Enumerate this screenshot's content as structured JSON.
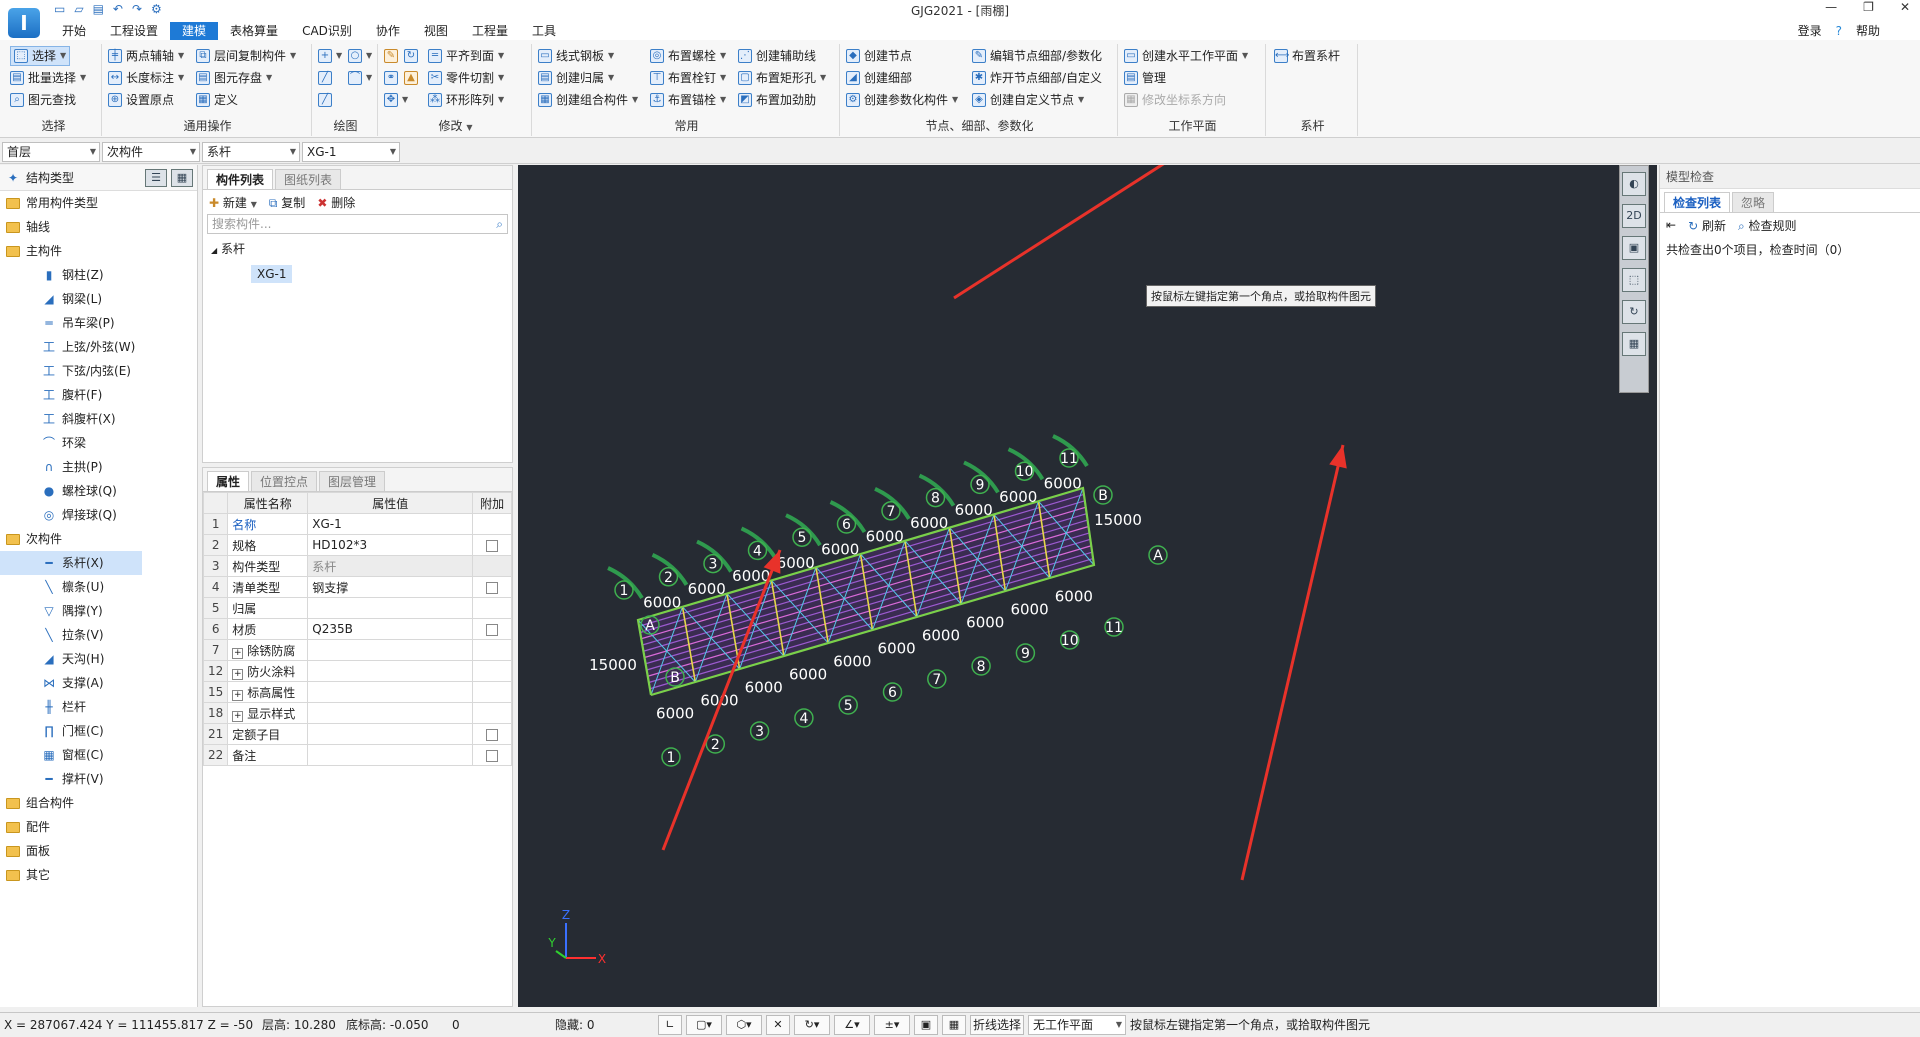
{
  "app": {
    "title": "GJG2021 - [雨棚]",
    "logo": "I",
    "qat": [
      "▭",
      "▱",
      "▤",
      "↶",
      "↷",
      "⚙"
    ],
    "window_controls": [
      "—",
      "❐",
      "✕"
    ],
    "login": "登录",
    "help": "帮助"
  },
  "menu": [
    "开始",
    "工程设置",
    "建模",
    "表格算量",
    "CAD识别",
    "协作",
    "视图",
    "工程量",
    "工具"
  ],
  "ribbon": {
    "select_group": {
      "label": "选择",
      "items": [
        "选择",
        "批量选择",
        "图元查找"
      ]
    },
    "common_ops": {
      "label": "通用操作",
      "items": [
        "两点辅轴",
        "长度标注",
        "设置原点",
        "层间复制构件",
        "图元存盘",
        "定义"
      ]
    },
    "draw": {
      "label": "绘图"
    },
    "modify": {
      "label": "修改",
      "items": [
        "平齐到面",
        "零件切割",
        "环形阵列"
      ]
    },
    "common": {
      "label": "常用",
      "items": [
        "线式钢板",
        "创建归属",
        "创建组合构件",
        "布置螺栓",
        "布置栓钉",
        "布置锚栓",
        "创建辅助线",
        "布置矩形孔",
        "布置加劲肋"
      ]
    },
    "nodes": {
      "label": "节点、细部、参数化",
      "items": [
        "创建节点",
        "创建细部",
        "创建参数化构件",
        "编辑节点细部/参数化",
        "炸开节点细部/自定义",
        "创建自定义节点"
      ]
    },
    "workplane": {
      "label": "工作平面",
      "items": [
        "创建水平工作平面",
        "管理",
        "修改坐标系方向"
      ]
    },
    "tie": {
      "label": "系杆",
      "items": [
        "布置系杆"
      ]
    }
  },
  "selectors": [
    "首层",
    "次构件",
    "系杆",
    "XG-1"
  ],
  "tree": {
    "header": "结构类型",
    "items": [
      {
        "label": "常用构件类型",
        "level": 1,
        "icon": "folder"
      },
      {
        "label": "轴线",
        "level": 1,
        "icon": "folder"
      },
      {
        "label": "主构件",
        "level": 1,
        "icon": "folder"
      },
      {
        "label": "钢柱(Z)",
        "level": 2,
        "icon": "▮"
      },
      {
        "label": "钢梁(L)",
        "level": 2,
        "icon": "◢"
      },
      {
        "label": "吊车梁(P)",
        "level": 2,
        "icon": "═"
      },
      {
        "label": "上弦/外弦(W)",
        "level": 2,
        "icon": "工"
      },
      {
        "label": "下弦/内弦(E)",
        "level": 2,
        "icon": "工"
      },
      {
        "label": "腹杆(F)",
        "level": 2,
        "icon": "工"
      },
      {
        "label": "斜腹杆(X)",
        "level": 2,
        "icon": "工"
      },
      {
        "label": "环梁",
        "level": 2,
        "icon": "⌒"
      },
      {
        "label": "主拱(P)",
        "level": 2,
        "icon": "∩"
      },
      {
        "label": "螺栓球(Q)",
        "level": 2,
        "icon": "●"
      },
      {
        "label": "焊接球(Q)",
        "level": 2,
        "icon": "◎"
      },
      {
        "label": "次构件",
        "level": 1,
        "icon": "folder"
      },
      {
        "label": "系杆(X)",
        "level": 2,
        "icon": "━",
        "selected": true
      },
      {
        "label": "檩条(U)",
        "level": 2,
        "icon": "╲"
      },
      {
        "label": "隅撑(Y)",
        "level": 2,
        "icon": "▽"
      },
      {
        "label": "拉条(V)",
        "level": 2,
        "icon": "╲"
      },
      {
        "label": "天沟(H)",
        "level": 2,
        "icon": "◢"
      },
      {
        "label": "支撑(A)",
        "level": 2,
        "icon": "⋈"
      },
      {
        "label": "栏杆",
        "level": 2,
        "icon": "╫"
      },
      {
        "label": "门框(C)",
        "level": 2,
        "icon": "∏"
      },
      {
        "label": "窗框(C)",
        "level": 2,
        "icon": "▦"
      },
      {
        "label": "撑杆(V)",
        "level": 2,
        "icon": "━"
      },
      {
        "label": "组合构件",
        "level": 1,
        "icon": "folder"
      },
      {
        "label": "配件",
        "level": 1,
        "icon": "folder"
      },
      {
        "label": "面板",
        "level": 1,
        "icon": "folder"
      },
      {
        "label": "其它",
        "level": 1,
        "icon": "folder"
      }
    ]
  },
  "component_list": {
    "tabs": [
      "构件列表",
      "图纸列表"
    ],
    "actions": [
      "新建",
      "复制",
      "删除"
    ],
    "search_placeholder": "搜索构件...",
    "group": "系杆",
    "item": "XG-1"
  },
  "properties": {
    "tabs": [
      "属性",
      "位置控点",
      "图层管理"
    ],
    "headers": [
      "属性名称",
      "属性值",
      "附加"
    ],
    "rows": [
      {
        "idx": "1",
        "name": "名称",
        "value": "XG-1",
        "check": false,
        "blue": true
      },
      {
        "idx": "2",
        "name": "规格",
        "value": "HD102*3",
        "check": true
      },
      {
        "idx": "3",
        "name": "构件类型",
        "value": "系杆",
        "check": false,
        "grey": true
      },
      {
        "idx": "4",
        "name": "清单类型",
        "value": "钢支撑",
        "check": true
      },
      {
        "idx": "5",
        "name": "归属",
        "value": "",
        "check": false
      },
      {
        "idx": "6",
        "name": "材质",
        "value": "Q235B",
        "check": true
      },
      {
        "idx": "7",
        "name": "除锈防腐",
        "value": "",
        "check": false,
        "expand": true
      },
      {
        "idx": "12",
        "name": "防火涂料",
        "value": "",
        "check": false,
        "expand": true
      },
      {
        "idx": "15",
        "name": "标高属性",
        "value": "",
        "check": false,
        "expand": true
      },
      {
        "idx": "18",
        "name": "显示样式",
        "value": "",
        "check": false,
        "expand": true
      },
      {
        "idx": "21",
        "name": "定额子目",
        "value": "",
        "check": true
      },
      {
        "idx": "22",
        "name": "备注",
        "value": "",
        "check": true
      }
    ]
  },
  "viewport": {
    "tooltip": "按鼠标左键指定第一个角点，或拾取构件图元",
    "dimension": "6000",
    "span": "15000",
    "axis_numbers": [
      "1",
      "2",
      "3",
      "4",
      "5",
      "6",
      "7",
      "8",
      "9",
      "10",
      "11"
    ],
    "axis_letters": [
      "A",
      "B"
    ],
    "axis_labels": {
      "x": "X",
      "y": "Y",
      "z": "Z"
    },
    "view_tools": [
      "◐",
      "2D",
      "▣",
      "⬚",
      "↻",
      "▦"
    ]
  },
  "model_check": {
    "title": "模型检查",
    "tabs": [
      "检查列表",
      "忽略"
    ],
    "actions": [
      "刷新",
      "检查规则"
    ],
    "summary": "共检查出0个项目，检查时间（0）"
  },
  "status": {
    "coords": "X = 287067.424 Y = 111455.817 Z = -50",
    "floor_height": "层高: 10.280",
    "bottom_elev": "底标高: -0.050",
    "zero": "0",
    "hidden": "隐藏: 0",
    "polyline": "折线选择",
    "workplane": "无工作平面",
    "prompt": "按鼠标左键指定第一个角点，或拾取构件图元"
  }
}
